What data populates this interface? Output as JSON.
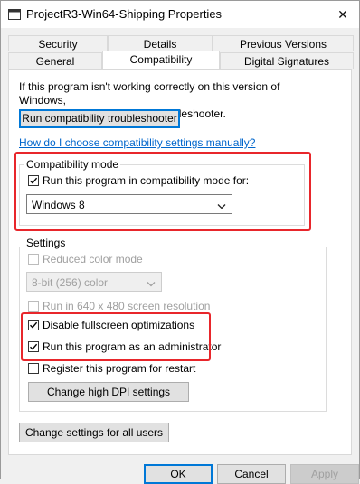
{
  "window": {
    "title": "ProjectR3-Win64-Shipping Properties"
  },
  "tabs": {
    "row1": [
      "Security",
      "Details",
      "Previous Versions"
    ],
    "row2": [
      "General",
      "Compatibility",
      "Digital Signatures"
    ],
    "active": "Compatibility"
  },
  "intro": {
    "line1": "If this program isn't working correctly on this version of Windows,",
    "line2": "try running the compatibility troubleshooter."
  },
  "troubleshooter_button": "Run compatibility troubleshooter",
  "help_link": "How do I choose compatibility settings manually?",
  "compat_mode": {
    "legend": "Compatibility mode",
    "checkbox_label": "Run this program in compatibility mode for:",
    "checked": true,
    "selected_os": "Windows 8"
  },
  "settings": {
    "legend": "Settings",
    "reduced_color": {
      "label": "Reduced color mode",
      "checked": false,
      "enabled": false
    },
    "color_select": {
      "value": "8-bit (256) color",
      "enabled": false
    },
    "res_640": {
      "label": "Run in 640 x 480 screen resolution",
      "checked": false,
      "enabled": false
    },
    "disable_fullscreen": {
      "label": "Disable fullscreen optimizations",
      "checked": true
    },
    "run_as_admin": {
      "label": "Run this program as an administrator",
      "checked": true
    },
    "register_restart": {
      "label": "Register this program for restart",
      "checked": false
    },
    "dpi_button": "Change high DPI settings"
  },
  "all_users_button": "Change settings for all users",
  "footer": {
    "ok": "OK",
    "cancel": "Cancel",
    "apply": "Apply"
  },
  "colors": {
    "highlight": "#e8262b",
    "link": "#0066cc",
    "focus": "#0078d7"
  }
}
